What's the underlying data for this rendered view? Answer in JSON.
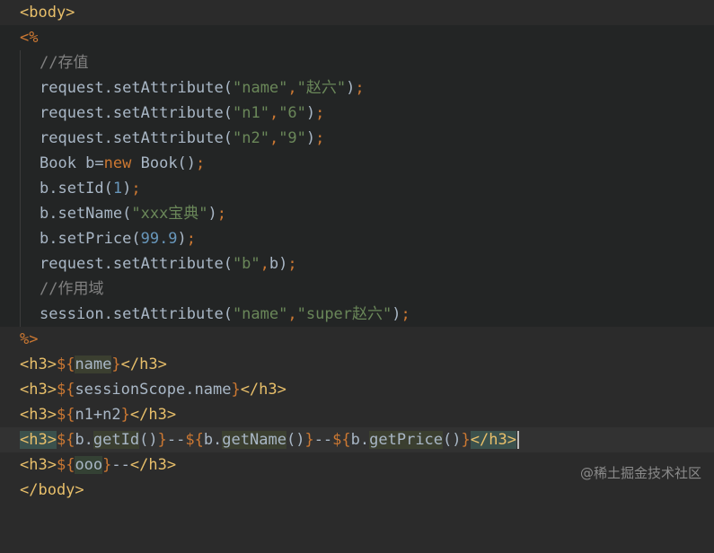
{
  "lines": {
    "l1": {
      "body_open": "<body>"
    },
    "l2": {
      "scriptlet_open": "<%"
    },
    "l3": {
      "comment": "//存值"
    },
    "l4": {
      "obj": "request",
      "dot": ".",
      "method": "setAttribute",
      "open": "(",
      "arg1": "\"name\"",
      "comma": ",",
      "arg2": "\"赵六\"",
      "close": ")",
      "semi": ";"
    },
    "l5": {
      "obj": "request",
      "dot": ".",
      "method": "setAttribute",
      "open": "(",
      "arg1": "\"n1\"",
      "comma": ",",
      "arg2": "\"6\"",
      "close": ")",
      "semi": ";"
    },
    "l6": {
      "obj": "request",
      "dot": ".",
      "method": "setAttribute",
      "open": "(",
      "arg1": "\"n2\"",
      "comma": ",",
      "arg2": "\"9\"",
      "close": ")",
      "semi": ";"
    },
    "l7": {
      "type": "Book b=",
      "kw": "new",
      "ctor": " Book()",
      "semi": ";"
    },
    "l8": {
      "text": "b.setId(",
      "num": "1",
      "close": ")",
      "semi": ";"
    },
    "l9": {
      "text": "b.setName(",
      "str": "\"xxx宝典\"",
      "close": ")",
      "semi": ";"
    },
    "l10": {
      "text": "b.setPrice(",
      "num": "99.9",
      "close": ")",
      "semi": ";"
    },
    "l11": {
      "text": "request.setAttribute(",
      "str": "\"b\"",
      "comma": ",",
      "rest": "b)",
      "semi": ";"
    },
    "l12": {
      "comment": "//作用域"
    },
    "l13": {
      "text": "session.setAttribute(",
      "arg1": "\"name\"",
      "comma": ",",
      "arg2": "\"super赵六\"",
      "close": ")",
      "semi": ";"
    },
    "l14": {
      "scriptlet_close": "%>"
    },
    "l15": {
      "tag_open": "<h3>",
      "el_open": "${",
      "expr": "name",
      "el_close": "}",
      "tag_close": "</h3>"
    },
    "l16": {
      "tag_open": "<h3>",
      "el_open": "${",
      "expr": "sessionScope.name",
      "el_close": "}",
      "tag_close": "</h3>"
    },
    "l17": {
      "tag_open": "<h3>",
      "el_open": "${",
      "expr": "n1+n2",
      "el_close": "}",
      "tag_close": "</h3>"
    },
    "l18": {
      "tag_open": "<h3>",
      "el1_open": "${",
      "e1_obj": "b.",
      "e1_m": "getId",
      "e1_p": "()",
      "el1_close": "}",
      "sep1": "--",
      "el2_open": "${",
      "e2_obj": "b.",
      "e2_m": "getName",
      "e2_p": "()",
      "el2_close": "}",
      "sep2": "--",
      "el3_open": "${",
      "e3_obj": "b.",
      "e3_m": "getPrice",
      "e3_p": "()",
      "el3_close": "}",
      "tag_close": "</h3>"
    },
    "l19": {
      "tag_open": "<h3>",
      "el_open": "${",
      "expr": "ooo",
      "el_close": "}",
      "sep": "--",
      "tag_close": "</h3>"
    },
    "l20": {
      "body_close": "</body>"
    }
  },
  "watermark": "@稀土掘金技术社区"
}
